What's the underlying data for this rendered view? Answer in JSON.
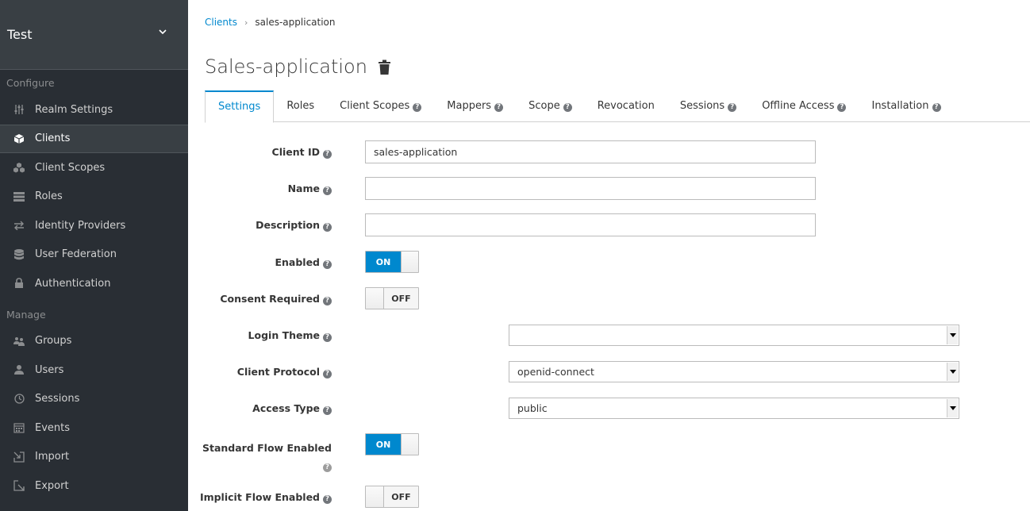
{
  "sidebar": {
    "realm": "Test",
    "configure_label": "Configure",
    "configure_items": [
      {
        "label": "Realm Settings",
        "icon": "sliders-icon"
      },
      {
        "label": "Clients",
        "icon": "cube-icon",
        "active": true
      },
      {
        "label": "Client Scopes",
        "icon": "cubes-icon"
      },
      {
        "label": "Roles",
        "icon": "list-icon"
      },
      {
        "label": "Identity Providers",
        "icon": "exchange-icon"
      },
      {
        "label": "User Federation",
        "icon": "database-icon"
      },
      {
        "label": "Authentication",
        "icon": "lock-icon"
      }
    ],
    "manage_label": "Manage",
    "manage_items": [
      {
        "label": "Groups",
        "icon": "users-icon"
      },
      {
        "label": "Users",
        "icon": "user-icon"
      },
      {
        "label": "Sessions",
        "icon": "clock-icon"
      },
      {
        "label": "Events",
        "icon": "calendar-icon"
      },
      {
        "label": "Import",
        "icon": "import-icon"
      },
      {
        "label": "Export",
        "icon": "export-icon"
      }
    ]
  },
  "breadcrumb": {
    "root": "Clients",
    "separator": "›",
    "current": "sales-application"
  },
  "page_title": "Sales-application",
  "tabs": [
    {
      "label": "Settings",
      "help": false,
      "active": true
    },
    {
      "label": "Roles",
      "help": false
    },
    {
      "label": "Client Scopes",
      "help": true
    },
    {
      "label": "Mappers",
      "help": true
    },
    {
      "label": "Scope",
      "help": true
    },
    {
      "label": "Revocation",
      "help": false
    },
    {
      "label": "Sessions",
      "help": true
    },
    {
      "label": "Offline Access",
      "help": true
    },
    {
      "label": "Installation",
      "help": true
    }
  ],
  "form": {
    "client_id": {
      "label": "Client ID",
      "value": "sales-application"
    },
    "name": {
      "label": "Name",
      "value": ""
    },
    "description": {
      "label": "Description",
      "value": ""
    },
    "enabled": {
      "label": "Enabled",
      "state": "ON"
    },
    "consent_required": {
      "label": "Consent Required",
      "state": "OFF"
    },
    "login_theme": {
      "label": "Login Theme",
      "value": ""
    },
    "client_protocol": {
      "label": "Client Protocol",
      "value": "openid-connect"
    },
    "access_type": {
      "label": "Access Type",
      "value": "public"
    },
    "standard_flow": {
      "label": "Standard Flow Enabled",
      "state": "ON"
    },
    "implicit_flow": {
      "label": "Implicit Flow Enabled",
      "state": "OFF"
    }
  },
  "colors": {
    "accent": "#0088ce",
    "sidebar_bg": "#292e34",
    "sidebar_active": "#393f44"
  }
}
